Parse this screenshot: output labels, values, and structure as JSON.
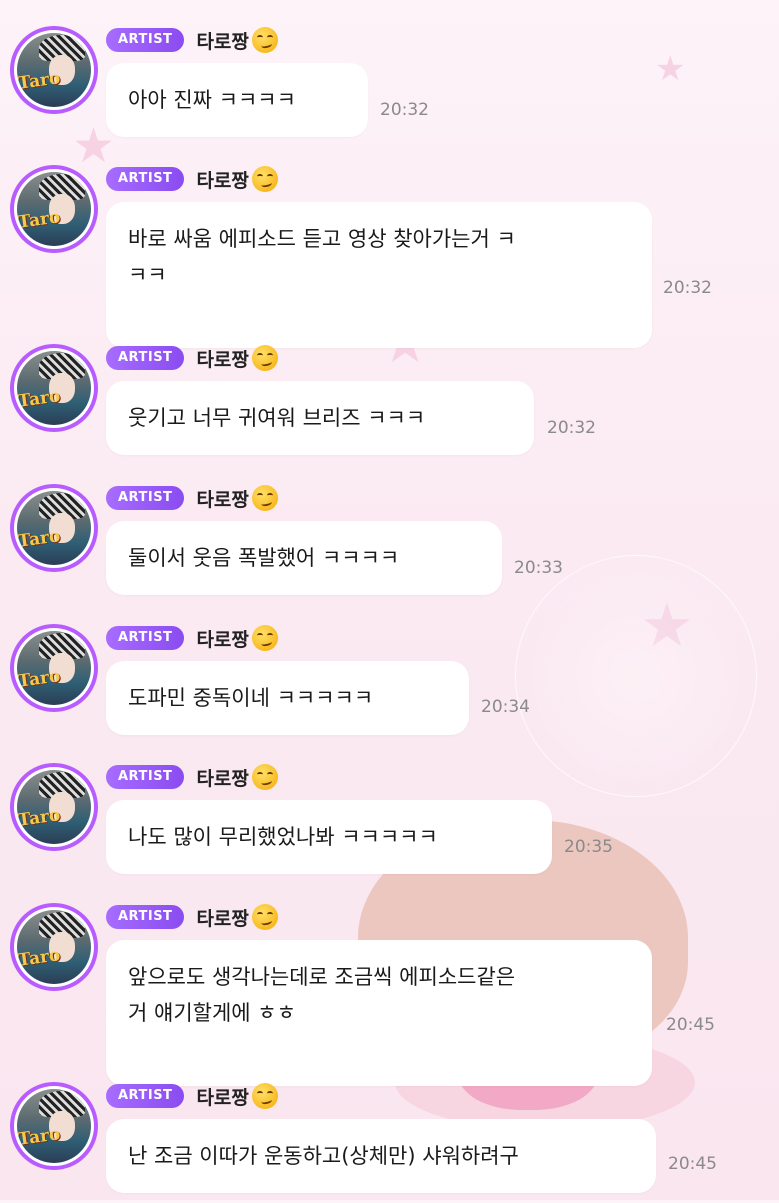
{
  "badge_label": "ARTIST",
  "sender_name": "타로짱",
  "sender_emoji": "smirking-face",
  "badge_color": "#9b5cf6",
  "avatar_ring_color": "#b85cff",
  "avatar_caption": "Taro",
  "messages": [
    {
      "text": "아아 진짜 ㅋㅋㅋㅋ",
      "time": "20:32"
    },
    {
      "text": "바로 싸움 에피소드 듣고 영상 찾아가는거 ㅋ\nㅋㅋ",
      "time": "20:32"
    },
    {
      "text": "웃기고 너무 귀여워 브리즈 ㅋㅋㅋ",
      "time": "20:32"
    },
    {
      "text": "둘이서 웃음 폭발했어 ㅋㅋㅋㅋ",
      "time": "20:33"
    },
    {
      "text": "도파민 중독이네 ㅋㅋㅋㅋㅋ",
      "time": "20:34"
    },
    {
      "text": "나도 많이 무리했었나봐 ㅋㅋㅋㅋㅋ",
      "time": "20:35"
    },
    {
      "text": "앞으로도 생각나는데로 조금씩 에피소드같은\n거 얘기할게에 ㅎㅎ",
      "time": "20:45"
    },
    {
      "text": "난 조금 이따가 운동하고(상체만) 샤워하려구",
      "time": "20:45"
    }
  ]
}
